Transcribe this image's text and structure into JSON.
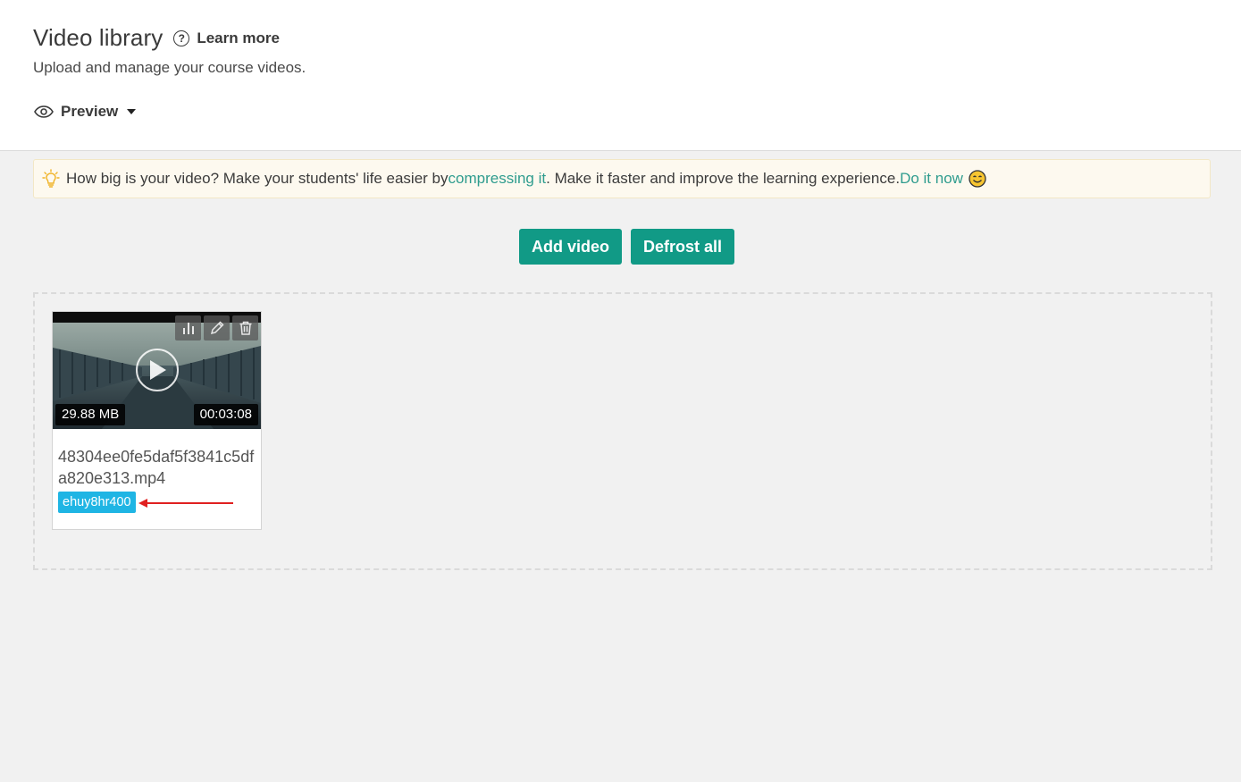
{
  "header": {
    "title": "Video library",
    "learn_more": "Learn more",
    "subtitle": "Upload and manage your course videos.",
    "preview_label": "Preview"
  },
  "tip": {
    "text_before": "How big is your video? Make your students' life easier by ",
    "link_compress": "compressing it",
    "text_middle": ". Make it faster and improve the learning experience. ",
    "link_do_now": "Do it now"
  },
  "actions": {
    "add_video": "Add video",
    "defrost_all": "Defrost all"
  },
  "videos": [
    {
      "size": "29.88 MB",
      "duration": "00:03:08",
      "filename": "48304ee0fe5daf5f3841c5dfa820e313.mp4",
      "tag": "ehuy8hr400"
    }
  ],
  "colors": {
    "accent": "#119a86",
    "link": "#2f9c8e",
    "tag": "#1fb5e4",
    "annotation_arrow": "#e02020"
  }
}
